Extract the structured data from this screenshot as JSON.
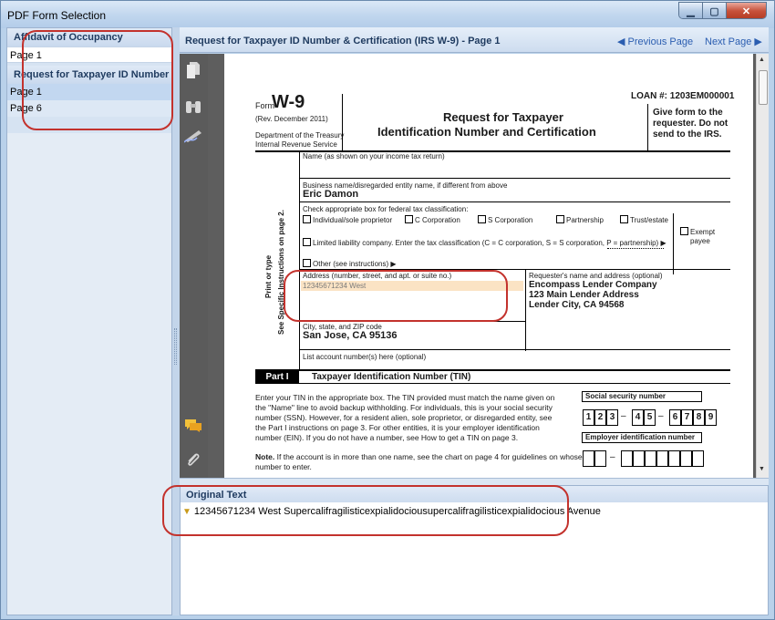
{
  "window": {
    "title": "PDF Form Selection"
  },
  "left_panel": {
    "sections": [
      {
        "header": "Affidavit of Occupancy",
        "items": [
          "Page 1"
        ]
      },
      {
        "header": "Request for Taxpayer ID Number",
        "items": [
          "Page 1",
          "Page 6"
        ]
      }
    ]
  },
  "doc_header": {
    "title": "Request for Taxpayer ID Number & Certification (IRS W-9) - Page 1",
    "prev_page": "◀ Previous Page",
    "next_page": "Next Page ▶"
  },
  "form": {
    "form_word": "Form",
    "form_number": "W-9",
    "revision": "(Rev. December 2011)",
    "department": "Department of the Treasury",
    "irs": "Internal Revenue Service",
    "title_line1": "Request for Taxpayer",
    "title_line2": "Identification Number and Certification",
    "loan_number": "LOAN #: 1203EM000001",
    "give_form_1": "Give form to the",
    "give_form_2": "requester. Do not",
    "give_form_3": "send to the IRS.",
    "side_print": "Print or type",
    "side_see": "See Specific Instructions on page 2.",
    "name_label": "Name (as shown on your income tax return)",
    "business_label": "Business name/disregarded entity name, if different from above",
    "business_value": "Eric Damon",
    "classification_label": "Check appropriate box for federal tax classification:",
    "cb_individual": "Individual/sole proprietor",
    "cb_c_corp": "C Corporation",
    "cb_s_corp": "S Corporation",
    "cb_partnership": "Partnership",
    "cb_trust": "Trust/estate",
    "exempt_1": "Exempt",
    "exempt_2": "payee",
    "cb_llc": "Limited liability company. Enter the tax classification (C = C corporation, S = S corporation, P = partnership) ▶",
    "cb_other": "Other (see instructions) ▶",
    "address_label": "Address (number, street, and apt. or suite no.)",
    "address_value": "12345671234 West",
    "requester_label": "Requester's name and address (optional)",
    "requester_line1": "Encompass Lender Company",
    "requester_line2": "123 Main Lender Address",
    "requester_line3": "Lender City, CA 94568",
    "city_label": "City, state, and ZIP code",
    "city_value": "San Jose, CA 95136",
    "account_label": "List account number(s) here (optional)",
    "part_label": "Part I",
    "part_title": "Taxpayer Identification Number (TIN)",
    "tin_text_1": "Enter your TIN in the appropriate box. The TIN provided must match the name given on",
    "tin_text_2": "the \"Name\" line to avoid backup withholding. For individuals, this is your social security",
    "tin_text_3": "number (SSN). However, for a resident alien, sole proprietor, or disregarded entity, see",
    "tin_text_4": "the Part I instructions on page 3. For other entities, it is your employer identification",
    "tin_text_5": "number (EIN). If you do not have a number, see How to get a TIN on page 3.",
    "note_word": "Note.",
    "note_text": "If the account is in more than one name, see the chart on page 4 for guidelines on whose",
    "note_text_2": "number to enter.",
    "ssn_label": "Social security number",
    "ssn_digits": [
      "1",
      "2",
      "3",
      "4",
      "5",
      "6",
      "7",
      "8",
      "9"
    ],
    "ein_label": "Employer identification number",
    "dash": "–"
  },
  "original_text": {
    "header": "Original Text",
    "value": "12345671234 West Supercalifragilisticexpialidociousupercalifragilisticexpialidocious Avenue"
  },
  "icons": [
    "page-icon",
    "binoculars-icon",
    "signature-icon",
    "comment-icon",
    "paperclip-icon",
    "flag-icon"
  ],
  "colors": {
    "annotation_red": "#c3322d",
    "link_blue": "#2a5db0",
    "toolstrip_gray": "#5b5b5b",
    "field_highlight": "#fbe3c4"
  }
}
